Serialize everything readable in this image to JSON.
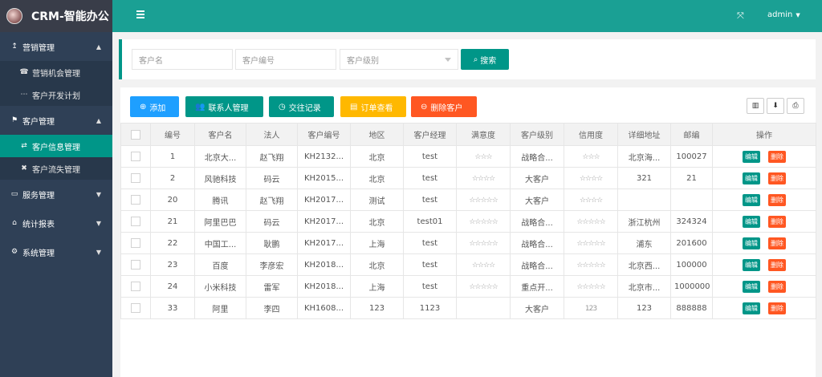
{
  "app": {
    "title": "CRM-智能办公"
  },
  "header": {
    "user": "admin"
  },
  "sidebar": {
    "groups": [
      {
        "label": "营销管理",
        "icon": "↥",
        "caret": "▲",
        "expanded": true,
        "items": [
          {
            "label": "营销机会管理",
            "icon": "☎",
            "active": false
          },
          {
            "label": "客户开发计划",
            "icon": "⋯",
            "active": false
          }
        ]
      },
      {
        "label": "客户管理",
        "icon": "⚑",
        "caret": "▲",
        "expanded": true,
        "items": [
          {
            "label": "客户信息管理",
            "icon": "⇄",
            "active": true
          },
          {
            "label": "客户流失管理",
            "icon": "✖",
            "active": false
          }
        ]
      },
      {
        "label": "服务管理",
        "icon": "▭",
        "caret": "▼",
        "expanded": false,
        "items": []
      },
      {
        "label": "统计报表",
        "icon": "⌂",
        "caret": "▼",
        "expanded": false,
        "items": []
      },
      {
        "label": "系统管理",
        "icon": "⚙",
        "caret": "▼",
        "expanded": false,
        "items": []
      }
    ]
  },
  "search": {
    "name_placeholder": "客户名",
    "code_placeholder": "客户编号",
    "level_placeholder": "客户级别",
    "button": "搜索"
  },
  "toolbar": {
    "add": "添加",
    "contacts": "联系人管理",
    "records": "交往记录",
    "orders": "订单查看",
    "delete": "删除客户"
  },
  "table": {
    "columns": [
      "编号",
      "客户名",
      "法人",
      "客户编号",
      "地区",
      "客户经理",
      "满意度",
      "客户级别",
      "信用度",
      "详细地址",
      "邮编",
      "操作"
    ],
    "edit_label": "编辑",
    "delete_label": "删除",
    "rows": [
      [
        "1",
        "北京大...",
        "赵飞翔",
        "KH2132...",
        "北京",
        "test",
        "☆☆☆",
        "战略合...",
        "☆☆☆",
        "北京海...",
        "100027"
      ],
      [
        "2",
        "风驰科技",
        "码云",
        "KH2015...",
        "北京",
        "test",
        "☆☆☆☆",
        "大客户",
        "☆☆☆☆",
        "321",
        "21"
      ],
      [
        "20",
        "腾讯",
        "赵飞翔",
        "KH2017...",
        "测试",
        "test",
        "☆☆☆☆☆",
        "大客户",
        "☆☆☆☆",
        "",
        ""
      ],
      [
        "21",
        "阿里巴巴",
        "码云",
        "KH2017...",
        "北京",
        "test01",
        "☆☆☆☆☆",
        "战略合...",
        "☆☆☆☆☆",
        "浙江杭州",
        "324324"
      ],
      [
        "22",
        "中国工...",
        "耿鹏",
        "KH2017...",
        "上海",
        "test",
        "☆☆☆☆☆",
        "战略合...",
        "☆☆☆☆☆",
        "浦东",
        "201600"
      ],
      [
        "23",
        "百度",
        "李彦宏",
        "KH2018...",
        "北京",
        "test",
        "☆☆☆☆",
        "战略合...",
        "☆☆☆☆☆",
        "北京西...",
        "100000"
      ],
      [
        "24",
        "小米科技",
        "雷军",
        "KH2018...",
        "上海",
        "test",
        "☆☆☆☆☆",
        "重点开...",
        "☆☆☆☆☆",
        "北京市...",
        "1000000"
      ],
      [
        "33",
        "阿里",
        "李四",
        "KH1608...",
        "123",
        "1123",
        "",
        "大客户",
        "123",
        "123",
        "888888"
      ]
    ]
  },
  "colors": {
    "primary": "#009688",
    "header": "#1aa094",
    "sidebar": "#2f4056",
    "blue": "#1e9fff",
    "orange": "#ffb800",
    "red": "#ff5722"
  }
}
